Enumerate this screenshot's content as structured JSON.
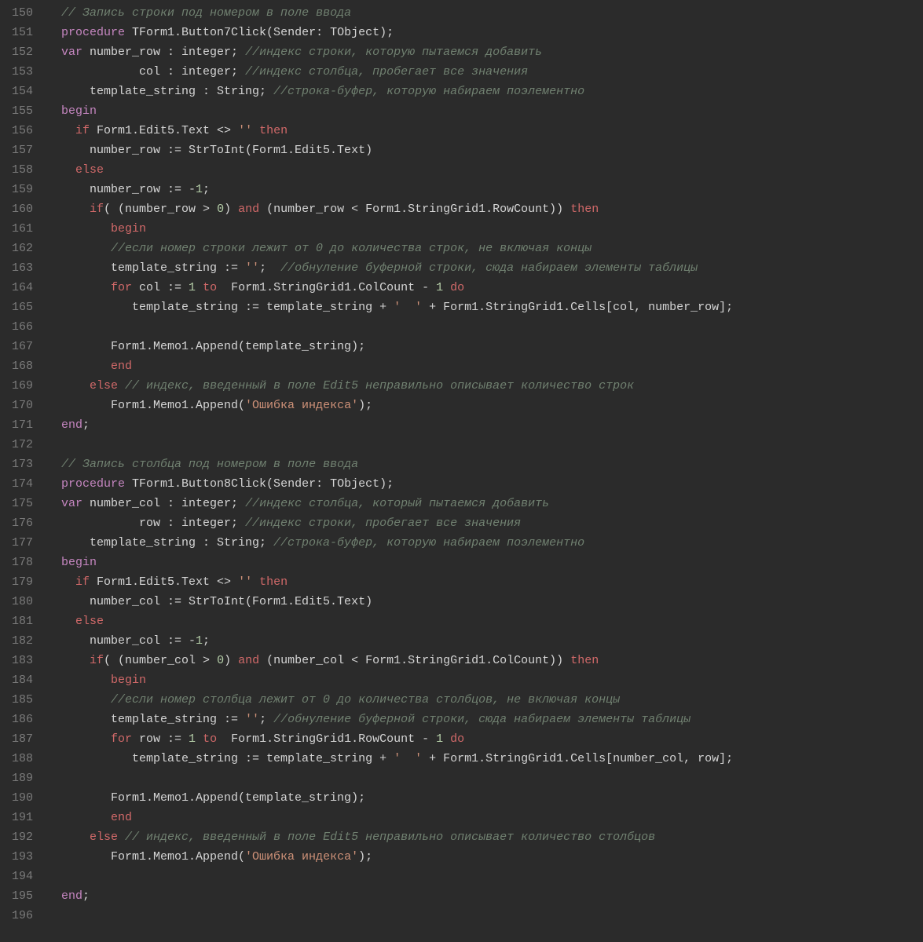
{
  "gutter": {
    "start": 150,
    "end": 196
  },
  "colors": {
    "keyword": "#c586c0",
    "keyword_red": "#d16969",
    "comment": "#708070",
    "string": "#ce9178",
    "number": "#b5cea8",
    "text": "#d4d4d4"
  },
  "code": {
    "lines": [
      {
        "n": 150,
        "spans": [
          {
            "t": "  ",
            "c": "text"
          },
          {
            "t": "// Запись строки под номером в поле ввода",
            "c": "comment"
          }
        ]
      },
      {
        "n": 151,
        "spans": [
          {
            "t": "  ",
            "c": "text"
          },
          {
            "t": "procedure",
            "c": "kw"
          },
          {
            "t": " TForm1.Button7Click(Sender: TObject);",
            "c": "text"
          }
        ]
      },
      {
        "n": 152,
        "spans": [
          {
            "t": "  ",
            "c": "text"
          },
          {
            "t": "var",
            "c": "kw"
          },
          {
            "t": " number_row : integer; ",
            "c": "text"
          },
          {
            "t": "//индекс строки, которую пытаемся добавить",
            "c": "comment"
          }
        ]
      },
      {
        "n": 153,
        "spans": [
          {
            "t": "             col : integer; ",
            "c": "text"
          },
          {
            "t": "//индекс столбца, пробегает все значения",
            "c": "comment"
          }
        ]
      },
      {
        "n": 154,
        "spans": [
          {
            "t": "      template_string : String; ",
            "c": "text"
          },
          {
            "t": "//строка-буфер, которую набираем поэлементно",
            "c": "comment"
          }
        ]
      },
      {
        "n": 155,
        "spans": [
          {
            "t": "  ",
            "c": "text"
          },
          {
            "t": "begin",
            "c": "kw"
          }
        ]
      },
      {
        "n": 156,
        "spans": [
          {
            "t": "    ",
            "c": "text"
          },
          {
            "t": "if",
            "c": "kw-red"
          },
          {
            "t": " Form1.Edit5.Text <> ",
            "c": "text"
          },
          {
            "t": "''",
            "c": "str"
          },
          {
            "t": " ",
            "c": "text"
          },
          {
            "t": "then",
            "c": "kw-red"
          }
        ]
      },
      {
        "n": 157,
        "spans": [
          {
            "t": "      number_row := StrToInt(Form1.Edit5.Text)",
            "c": "text"
          }
        ]
      },
      {
        "n": 158,
        "spans": [
          {
            "t": "    ",
            "c": "text"
          },
          {
            "t": "else",
            "c": "kw-red"
          }
        ]
      },
      {
        "n": 159,
        "spans": [
          {
            "t": "      number_row := -",
            "c": "text"
          },
          {
            "t": "1",
            "c": "num"
          },
          {
            "t": ";",
            "c": "text"
          }
        ]
      },
      {
        "n": 160,
        "spans": [
          {
            "t": "      ",
            "c": "text"
          },
          {
            "t": "if",
            "c": "kw-red"
          },
          {
            "t": "( (number_row > ",
            "c": "text"
          },
          {
            "t": "0",
            "c": "num"
          },
          {
            "t": ") ",
            "c": "text"
          },
          {
            "t": "and",
            "c": "kw-red"
          },
          {
            "t": " (number_row < Form1.StringGrid1.RowCount)) ",
            "c": "text"
          },
          {
            "t": "then",
            "c": "kw-red"
          }
        ]
      },
      {
        "n": 161,
        "spans": [
          {
            "t": "         ",
            "c": "text"
          },
          {
            "t": "begin",
            "c": "kw-red"
          }
        ]
      },
      {
        "n": 162,
        "spans": [
          {
            "t": "         ",
            "c": "text"
          },
          {
            "t": "//если номер строки лежит от 0 до количества строк, не включая концы",
            "c": "comment"
          }
        ]
      },
      {
        "n": 163,
        "spans": [
          {
            "t": "         template_string := ",
            "c": "text"
          },
          {
            "t": "''",
            "c": "str"
          },
          {
            "t": ";  ",
            "c": "text"
          },
          {
            "t": "//обнуление буферной строки, сюда набираем элементы таблицы",
            "c": "comment"
          }
        ]
      },
      {
        "n": 164,
        "spans": [
          {
            "t": "         ",
            "c": "text"
          },
          {
            "t": "for",
            "c": "kw-red"
          },
          {
            "t": " col := ",
            "c": "text"
          },
          {
            "t": "1",
            "c": "num"
          },
          {
            "t": " ",
            "c": "text"
          },
          {
            "t": "to",
            "c": "kw-red"
          },
          {
            "t": "  Form1.StringGrid1.ColCount - ",
            "c": "text"
          },
          {
            "t": "1",
            "c": "num"
          },
          {
            "t": " ",
            "c": "text"
          },
          {
            "t": "do",
            "c": "kw-red"
          }
        ]
      },
      {
        "n": 165,
        "spans": [
          {
            "t": "            template_string := template_string + ",
            "c": "text"
          },
          {
            "t": "'  '",
            "c": "str"
          },
          {
            "t": " + Form1.StringGrid1.Cells[col, number_row];",
            "c": "text"
          }
        ]
      },
      {
        "n": 166,
        "spans": [
          {
            "t": "",
            "c": "text"
          }
        ]
      },
      {
        "n": 167,
        "spans": [
          {
            "t": "         Form1.Memo1.Append(template_string);",
            "c": "text"
          }
        ]
      },
      {
        "n": 168,
        "spans": [
          {
            "t": "         ",
            "c": "text"
          },
          {
            "t": "end",
            "c": "kw-red"
          }
        ]
      },
      {
        "n": 169,
        "spans": [
          {
            "t": "      ",
            "c": "text"
          },
          {
            "t": "else",
            "c": "kw-red"
          },
          {
            "t": " ",
            "c": "text"
          },
          {
            "t": "// индекс, введенный в поле Edit5 неправильно описывает количество строк",
            "c": "comment"
          }
        ]
      },
      {
        "n": 170,
        "spans": [
          {
            "t": "         Form1.Memo1.Append(",
            "c": "text"
          },
          {
            "t": "'Ошибка индекса'",
            "c": "str"
          },
          {
            "t": ");",
            "c": "text"
          }
        ]
      },
      {
        "n": 171,
        "spans": [
          {
            "t": "  ",
            "c": "text"
          },
          {
            "t": "end",
            "c": "kw"
          },
          {
            "t": ";",
            "c": "text"
          }
        ]
      },
      {
        "n": 172,
        "spans": [
          {
            "t": "",
            "c": "text"
          }
        ]
      },
      {
        "n": 173,
        "spans": [
          {
            "t": "  ",
            "c": "text"
          },
          {
            "t": "// Запись столбца под номером в поле ввода",
            "c": "comment"
          }
        ]
      },
      {
        "n": 174,
        "spans": [
          {
            "t": "  ",
            "c": "text"
          },
          {
            "t": "procedure",
            "c": "kw"
          },
          {
            "t": " TForm1.Button8Click(Sender: TObject);",
            "c": "text"
          }
        ]
      },
      {
        "n": 175,
        "spans": [
          {
            "t": "  ",
            "c": "text"
          },
          {
            "t": "var",
            "c": "kw"
          },
          {
            "t": " number_col : integer; ",
            "c": "text"
          },
          {
            "t": "//индекс столбца, который пытаемся добавить",
            "c": "comment"
          }
        ]
      },
      {
        "n": 176,
        "spans": [
          {
            "t": "             row : integer; ",
            "c": "text"
          },
          {
            "t": "//индекс строки, пробегает все значения",
            "c": "comment"
          }
        ]
      },
      {
        "n": 177,
        "spans": [
          {
            "t": "      template_string : String; ",
            "c": "text"
          },
          {
            "t": "//строка-буфер, которую набираем поэлементно",
            "c": "comment"
          }
        ]
      },
      {
        "n": 178,
        "spans": [
          {
            "t": "  ",
            "c": "text"
          },
          {
            "t": "begin",
            "c": "kw"
          }
        ]
      },
      {
        "n": 179,
        "spans": [
          {
            "t": "    ",
            "c": "text"
          },
          {
            "t": "if",
            "c": "kw-red"
          },
          {
            "t": " Form1.Edit5.Text <> ",
            "c": "text"
          },
          {
            "t": "''",
            "c": "str"
          },
          {
            "t": " ",
            "c": "text"
          },
          {
            "t": "then",
            "c": "kw-red"
          }
        ]
      },
      {
        "n": 180,
        "spans": [
          {
            "t": "      number_col := StrToInt(Form1.Edit5.Text)",
            "c": "text"
          }
        ]
      },
      {
        "n": 181,
        "spans": [
          {
            "t": "    ",
            "c": "text"
          },
          {
            "t": "else",
            "c": "kw-red"
          }
        ]
      },
      {
        "n": 182,
        "spans": [
          {
            "t": "      number_col := -",
            "c": "text"
          },
          {
            "t": "1",
            "c": "num"
          },
          {
            "t": ";",
            "c": "text"
          }
        ]
      },
      {
        "n": 183,
        "spans": [
          {
            "t": "      ",
            "c": "text"
          },
          {
            "t": "if",
            "c": "kw-red"
          },
          {
            "t": "( (number_col > ",
            "c": "text"
          },
          {
            "t": "0",
            "c": "num"
          },
          {
            "t": ") ",
            "c": "text"
          },
          {
            "t": "and",
            "c": "kw-red"
          },
          {
            "t": " (number_col < Form1.StringGrid1.ColCount)) ",
            "c": "text"
          },
          {
            "t": "then",
            "c": "kw-red"
          }
        ]
      },
      {
        "n": 184,
        "spans": [
          {
            "t": "         ",
            "c": "text"
          },
          {
            "t": "begin",
            "c": "kw-red"
          }
        ]
      },
      {
        "n": 185,
        "spans": [
          {
            "t": "         ",
            "c": "text"
          },
          {
            "t": "//если номер столбца лежит от 0 до количества столбцов, не включая концы",
            "c": "comment"
          }
        ]
      },
      {
        "n": 186,
        "spans": [
          {
            "t": "         template_string := ",
            "c": "text"
          },
          {
            "t": "''",
            "c": "str"
          },
          {
            "t": "; ",
            "c": "text"
          },
          {
            "t": "//обнуление буферной строки, сюда набираем элементы таблицы",
            "c": "comment"
          }
        ]
      },
      {
        "n": 187,
        "spans": [
          {
            "t": "         ",
            "c": "text"
          },
          {
            "t": "for",
            "c": "kw-red"
          },
          {
            "t": " row := ",
            "c": "text"
          },
          {
            "t": "1",
            "c": "num"
          },
          {
            "t": " ",
            "c": "text"
          },
          {
            "t": "to",
            "c": "kw-red"
          },
          {
            "t": "  Form1.StringGrid1.RowCount - ",
            "c": "text"
          },
          {
            "t": "1",
            "c": "num"
          },
          {
            "t": " ",
            "c": "text"
          },
          {
            "t": "do",
            "c": "kw-red"
          }
        ]
      },
      {
        "n": 188,
        "spans": [
          {
            "t": "            template_string := template_string + ",
            "c": "text"
          },
          {
            "t": "'  '",
            "c": "str"
          },
          {
            "t": " + Form1.StringGrid1.Cells[number_col, row];",
            "c": "text"
          }
        ]
      },
      {
        "n": 189,
        "spans": [
          {
            "t": "",
            "c": "text"
          }
        ]
      },
      {
        "n": 190,
        "spans": [
          {
            "t": "         Form1.Memo1.Append(template_string);",
            "c": "text"
          }
        ]
      },
      {
        "n": 191,
        "spans": [
          {
            "t": "         ",
            "c": "text"
          },
          {
            "t": "end",
            "c": "kw-red"
          }
        ]
      },
      {
        "n": 192,
        "spans": [
          {
            "t": "      ",
            "c": "text"
          },
          {
            "t": "else",
            "c": "kw-red"
          },
          {
            "t": " ",
            "c": "text"
          },
          {
            "t": "// индекс, введенный в поле Edit5 неправильно описывает количество столбцов",
            "c": "comment"
          }
        ]
      },
      {
        "n": 193,
        "spans": [
          {
            "t": "         Form1.Memo1.Append(",
            "c": "text"
          },
          {
            "t": "'Ошибка индекса'",
            "c": "str"
          },
          {
            "t": ");",
            "c": "text"
          }
        ]
      },
      {
        "n": 194,
        "spans": [
          {
            "t": "",
            "c": "text"
          }
        ]
      },
      {
        "n": 195,
        "spans": [
          {
            "t": "  ",
            "c": "text"
          },
          {
            "t": "end",
            "c": "kw"
          },
          {
            "t": ";",
            "c": "text"
          }
        ]
      },
      {
        "n": 196,
        "spans": [
          {
            "t": "",
            "c": "text"
          }
        ]
      }
    ]
  }
}
